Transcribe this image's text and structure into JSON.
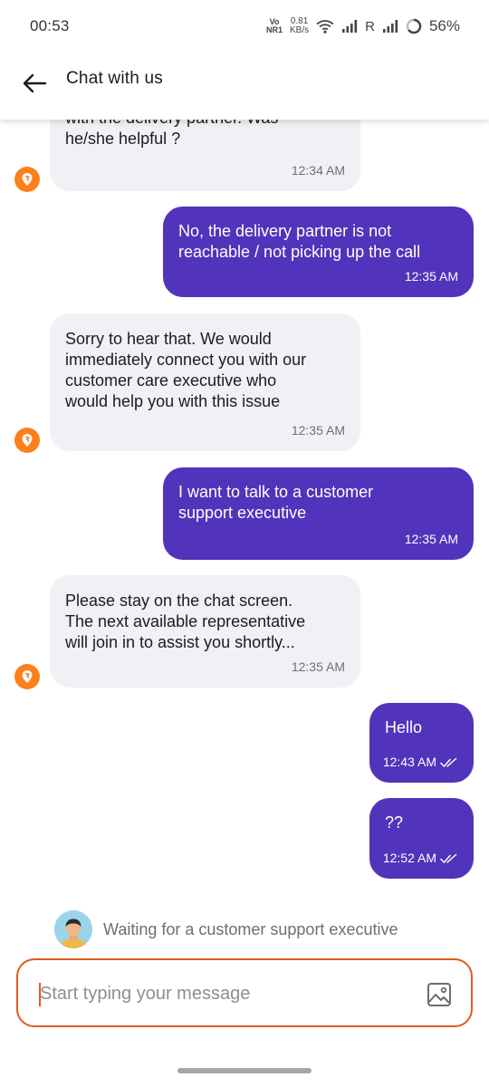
{
  "status_bar": {
    "time": "00:53",
    "volte_top": "Vo",
    "volte_bottom": "NR1",
    "speed_value": "0.81",
    "speed_unit": "KB/s",
    "roaming": "R",
    "battery": "56%"
  },
  "header": {
    "back_icon": "arrow-left-icon",
    "title": "Chat with us"
  },
  "colors": {
    "accent": "#5233bb",
    "brand": "#fc8019",
    "input_border": "#e25a1c",
    "bot_bubble": "#f0f0f5"
  },
  "messages": [
    {
      "sender": "bot",
      "text": "with the delivery partner. Was\nhe/she helpful ?",
      "time": "12:34 AM"
    },
    {
      "sender": "user",
      "text": "No, the delivery partner is not\nreachable / not picking up the call",
      "time": "12:35 AM"
    },
    {
      "sender": "bot",
      "text": "Sorry to hear that. We would\nimmediately connect you with our\ncustomer care executive who\nwould help you with this issue",
      "time": "12:35 AM"
    },
    {
      "sender": "user",
      "text": "I want to talk to a customer\nsupport executive",
      "time": "12:35 AM"
    },
    {
      "sender": "bot",
      "text": "Please stay on the chat screen.\nThe next available representative\nwill join in to assist you shortly...",
      "time": "12:35 AM"
    },
    {
      "sender": "user",
      "text": "Hello",
      "time": "12:43 AM",
      "status_icon": "double-check-icon"
    },
    {
      "sender": "user",
      "text": "??",
      "time": "12:52 AM",
      "status_icon": "double-check-icon"
    }
  ],
  "waiting": {
    "text": "Waiting for a customer support executive"
  },
  "input": {
    "placeholder": "Start typing your message",
    "value": "",
    "attach_icon": "image-icon"
  }
}
